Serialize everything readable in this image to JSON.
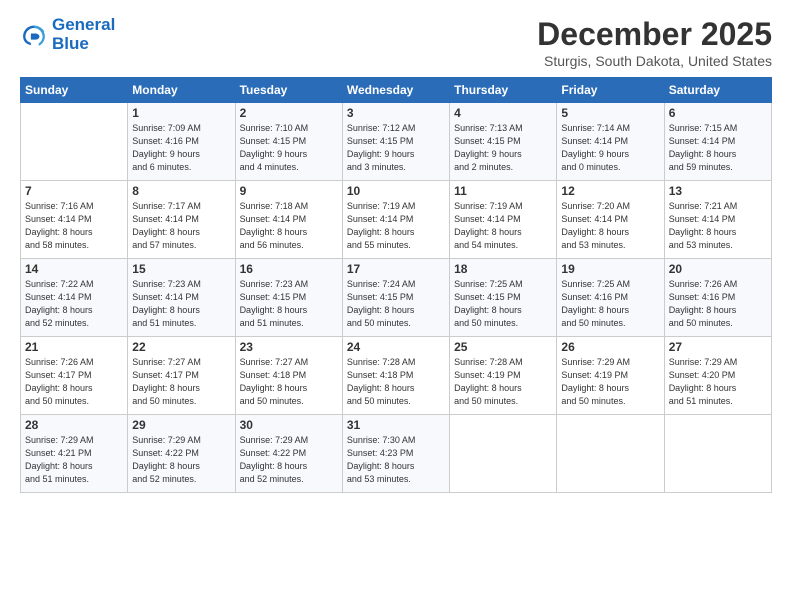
{
  "logo": {
    "line1": "General",
    "line2": "Blue"
  },
  "title": "December 2025",
  "location": "Sturgis, South Dakota, United States",
  "header": {
    "days": [
      "Sunday",
      "Monday",
      "Tuesday",
      "Wednesday",
      "Thursday",
      "Friday",
      "Saturday"
    ]
  },
  "weeks": [
    [
      {
        "num": "",
        "info": ""
      },
      {
        "num": "1",
        "info": "Sunrise: 7:09 AM\nSunset: 4:16 PM\nDaylight: 9 hours\nand 6 minutes."
      },
      {
        "num": "2",
        "info": "Sunrise: 7:10 AM\nSunset: 4:15 PM\nDaylight: 9 hours\nand 4 minutes."
      },
      {
        "num": "3",
        "info": "Sunrise: 7:12 AM\nSunset: 4:15 PM\nDaylight: 9 hours\nand 3 minutes."
      },
      {
        "num": "4",
        "info": "Sunrise: 7:13 AM\nSunset: 4:15 PM\nDaylight: 9 hours\nand 2 minutes."
      },
      {
        "num": "5",
        "info": "Sunrise: 7:14 AM\nSunset: 4:14 PM\nDaylight: 9 hours\nand 0 minutes."
      },
      {
        "num": "6",
        "info": "Sunrise: 7:15 AM\nSunset: 4:14 PM\nDaylight: 8 hours\nand 59 minutes."
      }
    ],
    [
      {
        "num": "7",
        "info": "Sunrise: 7:16 AM\nSunset: 4:14 PM\nDaylight: 8 hours\nand 58 minutes."
      },
      {
        "num": "8",
        "info": "Sunrise: 7:17 AM\nSunset: 4:14 PM\nDaylight: 8 hours\nand 57 minutes."
      },
      {
        "num": "9",
        "info": "Sunrise: 7:18 AM\nSunset: 4:14 PM\nDaylight: 8 hours\nand 56 minutes."
      },
      {
        "num": "10",
        "info": "Sunrise: 7:19 AM\nSunset: 4:14 PM\nDaylight: 8 hours\nand 55 minutes."
      },
      {
        "num": "11",
        "info": "Sunrise: 7:19 AM\nSunset: 4:14 PM\nDaylight: 8 hours\nand 54 minutes."
      },
      {
        "num": "12",
        "info": "Sunrise: 7:20 AM\nSunset: 4:14 PM\nDaylight: 8 hours\nand 53 minutes."
      },
      {
        "num": "13",
        "info": "Sunrise: 7:21 AM\nSunset: 4:14 PM\nDaylight: 8 hours\nand 53 minutes."
      }
    ],
    [
      {
        "num": "14",
        "info": "Sunrise: 7:22 AM\nSunset: 4:14 PM\nDaylight: 8 hours\nand 52 minutes."
      },
      {
        "num": "15",
        "info": "Sunrise: 7:23 AM\nSunset: 4:14 PM\nDaylight: 8 hours\nand 51 minutes."
      },
      {
        "num": "16",
        "info": "Sunrise: 7:23 AM\nSunset: 4:15 PM\nDaylight: 8 hours\nand 51 minutes."
      },
      {
        "num": "17",
        "info": "Sunrise: 7:24 AM\nSunset: 4:15 PM\nDaylight: 8 hours\nand 50 minutes."
      },
      {
        "num": "18",
        "info": "Sunrise: 7:25 AM\nSunset: 4:15 PM\nDaylight: 8 hours\nand 50 minutes."
      },
      {
        "num": "19",
        "info": "Sunrise: 7:25 AM\nSunset: 4:16 PM\nDaylight: 8 hours\nand 50 minutes."
      },
      {
        "num": "20",
        "info": "Sunrise: 7:26 AM\nSunset: 4:16 PM\nDaylight: 8 hours\nand 50 minutes."
      }
    ],
    [
      {
        "num": "21",
        "info": "Sunrise: 7:26 AM\nSunset: 4:17 PM\nDaylight: 8 hours\nand 50 minutes."
      },
      {
        "num": "22",
        "info": "Sunrise: 7:27 AM\nSunset: 4:17 PM\nDaylight: 8 hours\nand 50 minutes."
      },
      {
        "num": "23",
        "info": "Sunrise: 7:27 AM\nSunset: 4:18 PM\nDaylight: 8 hours\nand 50 minutes."
      },
      {
        "num": "24",
        "info": "Sunrise: 7:28 AM\nSunset: 4:18 PM\nDaylight: 8 hours\nand 50 minutes."
      },
      {
        "num": "25",
        "info": "Sunrise: 7:28 AM\nSunset: 4:19 PM\nDaylight: 8 hours\nand 50 minutes."
      },
      {
        "num": "26",
        "info": "Sunrise: 7:29 AM\nSunset: 4:19 PM\nDaylight: 8 hours\nand 50 minutes."
      },
      {
        "num": "27",
        "info": "Sunrise: 7:29 AM\nSunset: 4:20 PM\nDaylight: 8 hours\nand 51 minutes."
      }
    ],
    [
      {
        "num": "28",
        "info": "Sunrise: 7:29 AM\nSunset: 4:21 PM\nDaylight: 8 hours\nand 51 minutes."
      },
      {
        "num": "29",
        "info": "Sunrise: 7:29 AM\nSunset: 4:22 PM\nDaylight: 8 hours\nand 52 minutes."
      },
      {
        "num": "30",
        "info": "Sunrise: 7:29 AM\nSunset: 4:22 PM\nDaylight: 8 hours\nand 52 minutes."
      },
      {
        "num": "31",
        "info": "Sunrise: 7:30 AM\nSunset: 4:23 PM\nDaylight: 8 hours\nand 53 minutes."
      },
      {
        "num": "",
        "info": ""
      },
      {
        "num": "",
        "info": ""
      },
      {
        "num": "",
        "info": ""
      }
    ]
  ]
}
